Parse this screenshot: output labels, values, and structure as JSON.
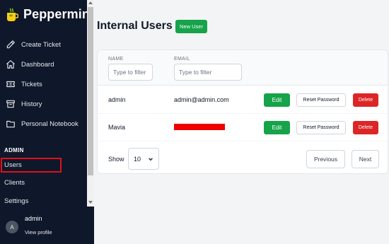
{
  "app": {
    "name": "Peppermint",
    "brand_color": "#84cc16"
  },
  "sidebar": {
    "items": [
      {
        "label": "Create Ticket",
        "icon": "pencil-icon"
      },
      {
        "label": "Dashboard",
        "icon": "home-icon"
      },
      {
        "label": "Tickets",
        "icon": "ticket-icon"
      },
      {
        "label": "History",
        "icon": "archive-icon"
      },
      {
        "label": "Personal Notebook",
        "icon": "folder-icon"
      }
    ],
    "section_label": "ADMIN",
    "admin_links": [
      "Users",
      "Clients",
      "Settings"
    ],
    "active_link": "Users",
    "highlight_color": "#e0101a"
  },
  "profile": {
    "initial": "A",
    "name": "admin",
    "link": "View profile"
  },
  "main": {
    "title": "Internal Users",
    "new_user_label": "New User",
    "columns": {
      "name": "NAME",
      "email": "EMAIL"
    },
    "filters": {
      "name_placeholder": "Type to filter",
      "email_placeholder": "Type to filter"
    },
    "rows": [
      {
        "name": "admin",
        "email": "admin@admin.com",
        "email_redacted": false
      },
      {
        "name": "Mavia",
        "email": "",
        "email_redacted": true
      }
    ],
    "actions": {
      "edit": "Edit",
      "reset": "Reset Password",
      "delete": "Delete"
    },
    "footer": {
      "show_label": "Show",
      "page_size": "10",
      "previous": "Previous",
      "next": "Next"
    },
    "colors": {
      "success": "#16a34a",
      "danger": "#dc2626"
    }
  }
}
